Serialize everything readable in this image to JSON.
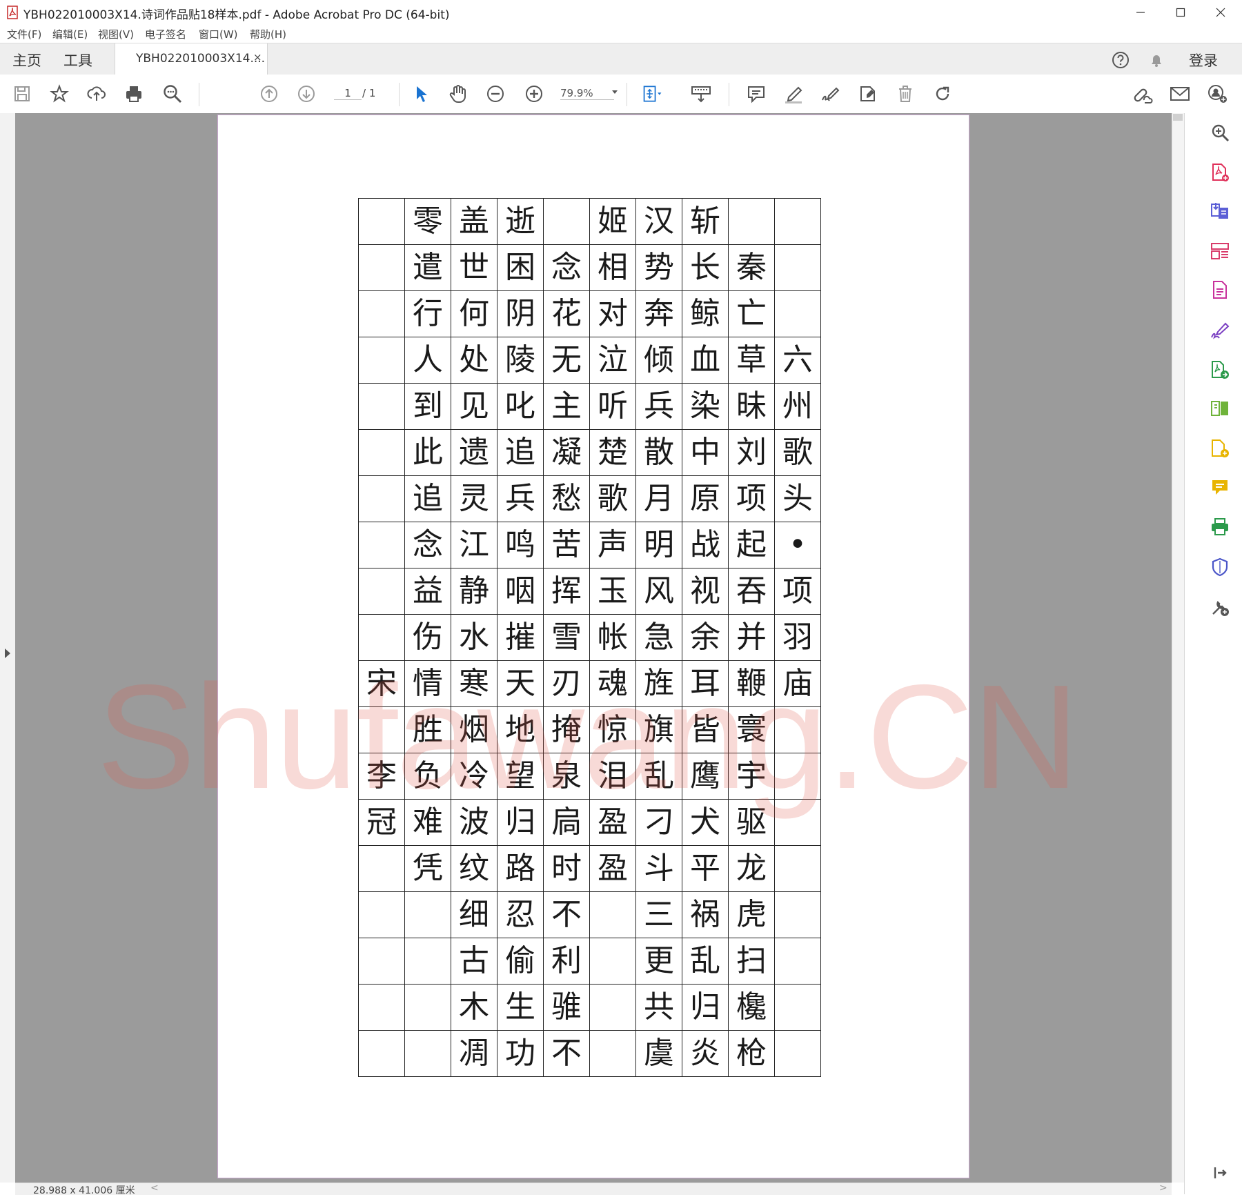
{
  "window": {
    "title": "YBH022010003X14.诗词作品贴18样本.pdf - Adobe Acrobat Pro DC (64-bit)",
    "minimize": "—",
    "maximize": "☐",
    "close": "✕"
  },
  "menu": [
    "文件(F)",
    "编辑(E)",
    "视图(V)",
    "电子签名",
    "窗口(W)",
    "帮助(H)"
  ],
  "tabs": {
    "home": "主页",
    "tools": "工具",
    "document": "YBH022010003X14....",
    "document_close": "×",
    "signin": "登录"
  },
  "toolbar": {
    "page_current": "1",
    "page_total": "/ 1",
    "zoom": "79.9%",
    "icons": [
      "save-icon",
      "bookmark-star-icon",
      "upload-cloud-icon",
      "print-icon",
      "search-zoom-icon",
      "prev-page-icon",
      "next-page-icon",
      "select-arrow-icon",
      "hand-tool-icon",
      "zoom-out-icon",
      "zoom-in-icon",
      "fit-page-icon",
      "keyboard-icon",
      "comment-icon",
      "highlight-pen-icon",
      "sign-icon",
      "stamp-icon",
      "delete-icon",
      "rotate-icon",
      "share-link-icon",
      "email-icon",
      "add-user-icon"
    ],
    "accent_color": "#1a73d1"
  },
  "right_panel": {
    "icons": [
      "zoom-search-icon",
      "create-pdf-icon",
      "export-pdf-icon",
      "organize-pages-icon",
      "edit-pdf-icon",
      "fill-sign-icon",
      "combine-files-icon",
      "compare-icon",
      "send-for-review-icon",
      "comment-tool-icon",
      "print-production-icon",
      "protect-icon",
      "more-tools-icon",
      "collapse-panel-icon"
    ],
    "colors": [
      "#555555",
      "#e0315a",
      "#5b5fd6",
      "#d93b6a",
      "#c8329c",
      "#7b3fc2",
      "#2b9a4b",
      "#6fb33a",
      "#e8b400",
      "#e8b400",
      "#2b9a4b",
      "#4a55c8",
      "#555555",
      "#555555"
    ]
  },
  "document": {
    "grid": [
      [
        "",
        "零",
        "盖",
        "逝",
        "",
        "姬",
        "汉",
        "斩",
        "",
        ""
      ],
      [
        "",
        "遣",
        "世",
        "困",
        "念",
        "相",
        "势",
        "长",
        "秦",
        ""
      ],
      [
        "",
        "行",
        "何",
        "阴",
        "花",
        "对",
        "奔",
        "鲸",
        "亡",
        ""
      ],
      [
        "",
        "人",
        "处",
        "陵",
        "无",
        "泣",
        "倾",
        "血",
        "草",
        "六"
      ],
      [
        "",
        "到",
        "见",
        "叱",
        "主",
        "听",
        "兵",
        "染",
        "昧",
        "州"
      ],
      [
        "",
        "此",
        "遗",
        "追",
        "凝",
        "楚",
        "散",
        "中",
        "刘",
        "歌"
      ],
      [
        "",
        "追",
        "灵",
        "兵",
        "愁",
        "歌",
        "月",
        "原",
        "项",
        "头"
      ],
      [
        "",
        "念",
        "江",
        "鸣",
        "苦",
        "声",
        "明",
        "战",
        "起",
        "•"
      ],
      [
        "",
        "益",
        "静",
        "咽",
        "挥",
        "玉",
        "风",
        "视",
        "吞",
        "项"
      ],
      [
        "",
        "伤",
        "水",
        "摧",
        "雪",
        "帐",
        "急",
        "余",
        "并",
        "羽"
      ],
      [
        "宋",
        "情",
        "寒",
        "天",
        "刃",
        "魂",
        "旌",
        "耳",
        "鞭",
        "庙"
      ],
      [
        "",
        "胜",
        "烟",
        "地",
        "掩",
        "惊",
        "旗",
        "皆",
        "寰",
        ""
      ],
      [
        "李",
        "负",
        "冷",
        "望",
        "泉",
        "泪",
        "乱",
        "鹰",
        "宇",
        ""
      ],
      [
        "冠",
        "难",
        "波",
        "归",
        "扃",
        "盈",
        "刁",
        "犬",
        "驱",
        ""
      ],
      [
        "",
        "凭",
        "纹",
        "路",
        "时",
        "盈",
        "斗",
        "平",
        "龙",
        ""
      ],
      [
        "",
        "",
        "细",
        "忍",
        "不",
        "",
        "三",
        "祸",
        "虎",
        ""
      ],
      [
        "",
        "",
        "古",
        "偷",
        "利",
        "",
        "更",
        "乱",
        "扫",
        ""
      ],
      [
        "",
        "",
        "木",
        "生",
        "骓",
        "",
        "共",
        "归",
        "欃",
        ""
      ],
      [
        "",
        "",
        "凋",
        "功",
        "不",
        "",
        "虞",
        "炎",
        "枪",
        ""
      ]
    ],
    "watermark": "Shufawang.CN"
  },
  "status": {
    "page_size": "28.988 x 41.006 厘米",
    "left_caret": "<",
    "right_caret": ">"
  }
}
